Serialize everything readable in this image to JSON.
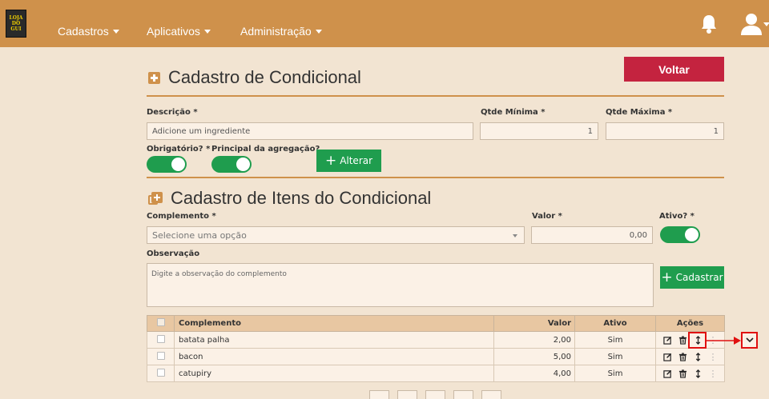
{
  "navbar": {
    "logo_lines": [
      "LOJA",
      "DO",
      "GUI"
    ],
    "menu": [
      {
        "label": "Cadastros"
      },
      {
        "label": "Aplicativos"
      },
      {
        "label": "Administração"
      }
    ]
  },
  "page": {
    "title": "Cadastro de Condicional",
    "back_button": "Voltar"
  },
  "form": {
    "descricao_label": "Descrição *",
    "descricao_value": "Adicione um ingrediente",
    "qtde_min_label": "Qtde Mínima *",
    "qtde_min_value": "1",
    "qtde_max_label": "Qtde Máxima *",
    "qtde_max_value": "1",
    "obrigatorio_label": "Obrigatório? *",
    "principal_label": "Principal da agregação?",
    "alterar_button": "Alterar"
  },
  "items_section": {
    "title": "Cadastro de Itens do Condicional",
    "complemento_label": "Complemento *",
    "complemento_placeholder": "Selecione uma opção",
    "valor_label": "Valor *",
    "valor_value": "0,00",
    "ativo_label": "Ativo? *",
    "observacao_label": "Observação",
    "observacao_placeholder": "Digite a observação do complemento",
    "cadastrar_button": "Cadastrar"
  },
  "table": {
    "headers": {
      "complemento": "Complemento",
      "valor": "Valor",
      "ativo": "Ativo",
      "acoes": "Ações"
    },
    "rows": [
      {
        "complemento": "batata palha",
        "valor": "2,00",
        "ativo": "Sim"
      },
      {
        "complemento": "bacon",
        "valor": "5,00",
        "ativo": "Sim"
      },
      {
        "complemento": "catupiry",
        "valor": "4,00",
        "ativo": "Sim"
      }
    ],
    "dots": "⋮"
  },
  "colors": {
    "navbar": "#cf914b",
    "background": "#f2e4d2",
    "danger": "#c4233f",
    "success": "#1f9d4e",
    "highlight": "#e01010"
  },
  "icons": [
    "bell-icon",
    "user-icon",
    "edit-icon",
    "trash-icon",
    "move-vertical-icon",
    "kebab-icon",
    "chevron-down-icon"
  ]
}
